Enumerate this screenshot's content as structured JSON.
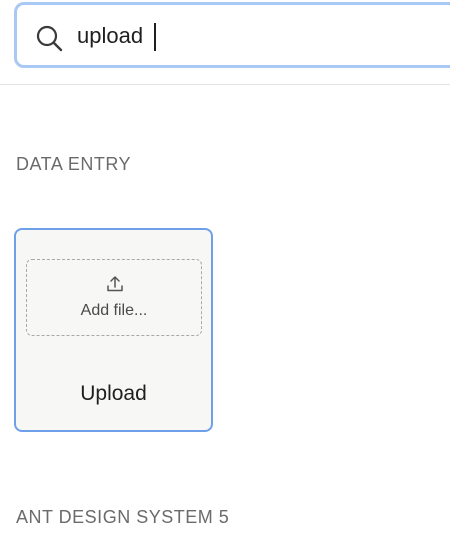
{
  "search": {
    "value": "upload",
    "icon": "search-icon"
  },
  "sections": [
    {
      "heading": "DATA ENTRY"
    },
    {
      "heading": "ANT DESIGN SYSTEM 5"
    }
  ],
  "cards": [
    {
      "title": "Upload",
      "dropzone_label": "Add file...",
      "icon": "upload-icon"
    }
  ],
  "colors": {
    "accent": "#6ea0ea",
    "search_focus": "#a9c9f5",
    "heading_text": "#6b6b6b",
    "card_bg": "#f7f7f5"
  }
}
